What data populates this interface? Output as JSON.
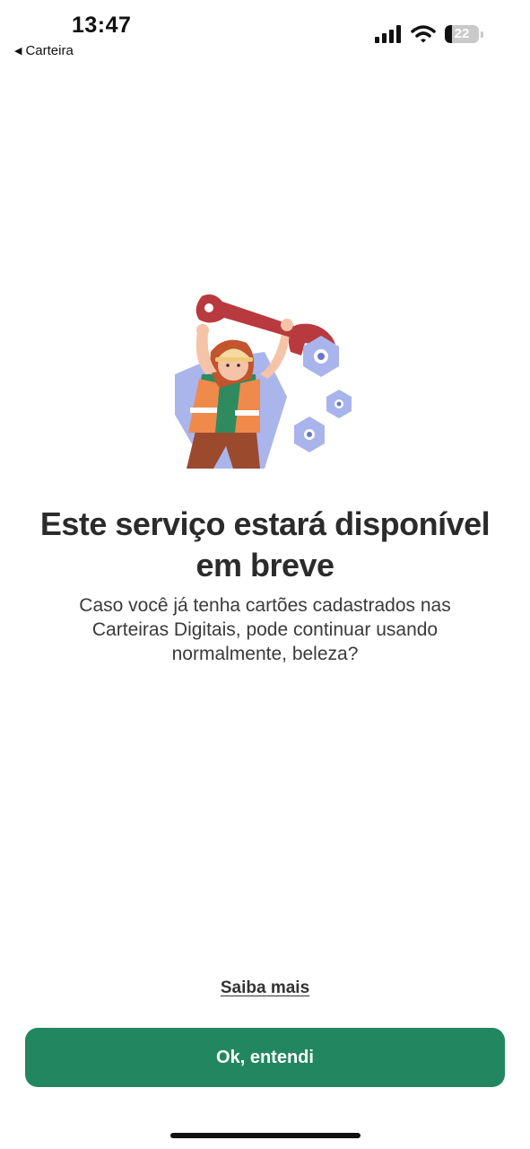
{
  "status_bar": {
    "time": "13:47",
    "back_label": "Carteira",
    "battery_level": "22",
    "battery_fraction": 0.22,
    "icons": [
      "signal-icon",
      "wifi-icon",
      "battery-icon"
    ]
  },
  "illustration": {
    "icon": "maintenance-worker-illustration",
    "colors": {
      "wrench": "#b83a3e",
      "bolts": "#a9b4ec",
      "vest": "#f08a4b",
      "shirt": "#2f8a5f"
    }
  },
  "content": {
    "headline": "Este serviço estará disponível em breve",
    "subtitle": "Caso você já tenha cartões cadastrados nas Carteiras Digitais, pode continuar usando normalmente, beleza?"
  },
  "actions": {
    "more_link": "Saiba mais",
    "primary_button": "Ok, entendi"
  },
  "colors": {
    "primary": "#228761",
    "text": "#2b2b2b"
  }
}
